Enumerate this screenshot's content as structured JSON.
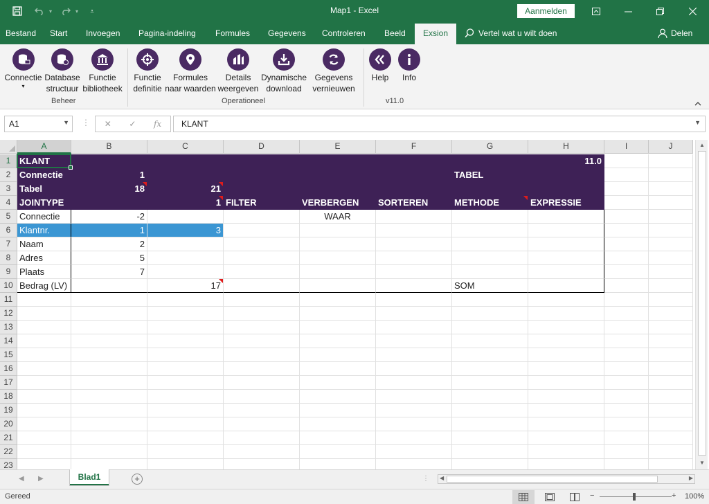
{
  "window": {
    "title": "Map1  -  Excel",
    "signin_label": "Aanmelden"
  },
  "tabs": [
    {
      "label": "Bestand"
    },
    {
      "label": "Start"
    },
    {
      "label": "Invoegen"
    },
    {
      "label": "Pagina-indeling"
    },
    {
      "label": "Formules"
    },
    {
      "label": "Gegevens"
    },
    {
      "label": "Controleren"
    },
    {
      "label": "Beeld"
    },
    {
      "label": "Exsion",
      "active": true
    }
  ],
  "tell_me": "Vertel wat u wilt doen",
  "share_label": "Delen",
  "ribbon": {
    "buttons": [
      {
        "line1": "Connectie",
        "line2": "",
        "icon": "database-plug-icon"
      },
      {
        "line1": "Database",
        "line2": "structuur",
        "icon": "database-structure-icon"
      },
      {
        "line1": "Functie",
        "line2": "bibliotheek",
        "icon": "library-icon"
      },
      {
        "line1": "Functie",
        "line2": "definitie",
        "icon": "crosshair-icon"
      },
      {
        "line1": "Formules",
        "line2": "naar waarden",
        "icon": "location-icon"
      },
      {
        "line1": "Details",
        "line2": "weergeven",
        "icon": "chart-icon"
      },
      {
        "line1": "Dynamische",
        "line2": "download",
        "icon": "download-icon"
      },
      {
        "line1": "Gegevens",
        "line2": "vernieuwen",
        "icon": "refresh-icon"
      },
      {
        "line1": "Help",
        "line2": "",
        "icon": "help-icon"
      },
      {
        "line1": "Info",
        "line2": "",
        "icon": "info-icon"
      }
    ],
    "groups": [
      "Beheer",
      "Operationeel",
      "v11.0"
    ]
  },
  "formula_bar": {
    "name_box": "A1",
    "formula": "KLANT"
  },
  "columns": [
    "A",
    "B",
    "C",
    "D",
    "E",
    "F",
    "G",
    "H",
    "I",
    "J"
  ],
  "rows": [
    "1",
    "2",
    "3",
    "4",
    "5",
    "6",
    "7",
    "8",
    "9",
    "10",
    "11",
    "12",
    "13",
    "14",
    "15",
    "16",
    "17",
    "18",
    "19",
    "20",
    "21",
    "22",
    "23"
  ],
  "cells": {
    "A1": "KLANT",
    "H1": "11.0",
    "A2": "Connectie",
    "B2": "1",
    "G2": "TABEL",
    "A3": "Tabel",
    "B3": "18",
    "C3": "21",
    "A4": "JOINTYPE",
    "C4": "1",
    "D4": "FILTER",
    "E4": "VERBERGEN",
    "F4": "SORTEREN",
    "G4": "METHODE",
    "H4": "EXPRESSIE",
    "A5": "Connectie",
    "B5": "-2",
    "E5": "WAAR",
    "A6": "Klantnr.",
    "B6": "1",
    "C6": "3",
    "A7": "Naam",
    "B7": "2",
    "A8": "Adres",
    "B8": "5",
    "A9": "Plaats",
    "B9": "7",
    "A10": "Bedrag (LV)",
    "C10": "17",
    "G10": "SOM"
  },
  "sheets": [
    {
      "name": "Blad1",
      "active": true
    }
  ],
  "status": {
    "ready": "Gereed",
    "zoom": "100%"
  },
  "colors": {
    "excel_green": "#217346",
    "exsion_purple": "#3e2156",
    "highlight_blue": "#3b96d3"
  }
}
